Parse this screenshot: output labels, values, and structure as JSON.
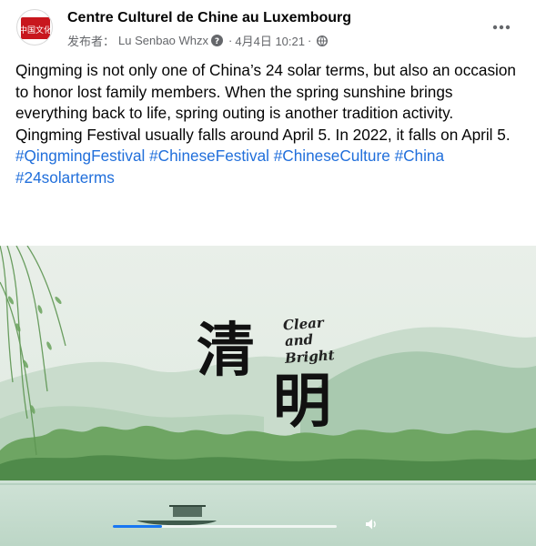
{
  "post": {
    "page_name": "Centre Culturel de Chine au Luxembourg",
    "publisher_label": "发布者：",
    "publisher_name": "Lu Senbao Whzx",
    "separator": "·",
    "date": "4月4日 10:21",
    "separator2": "·",
    "avatar_text": "中国文化",
    "icons": {
      "verified": "question-circle-icon",
      "audience": "globe-icon",
      "more": "more-horizontal-icon"
    },
    "paragraph_1": "Qingming is not only one of China’s 24 solar terms, but also an occasion to honor lost family members. When the spring sunshine brings everything back to life, spring outing is another tradition activity.",
    "paragraph_2": "Qingming Festival usually falls around April 5. In 2022, it falls on April 5.",
    "hashtags": [
      "#QingmingFestival",
      "#ChineseFestival",
      "#ChineseCulture",
      "#China",
      "#24solarterms"
    ]
  },
  "video": {
    "title_cn_1": "清",
    "title_cn_2": "明",
    "title_en_1": "Clear",
    "title_en_2": "and",
    "title_en_3": "Bright",
    "progress_fraction": 0.22,
    "colors": {
      "accent": "#1877f2",
      "link": "#216fdb",
      "sky": "#e8efe9",
      "hills": "#9fc4a6",
      "trees": "#5f9a57"
    },
    "icons": {
      "volume": "volume-icon"
    }
  }
}
